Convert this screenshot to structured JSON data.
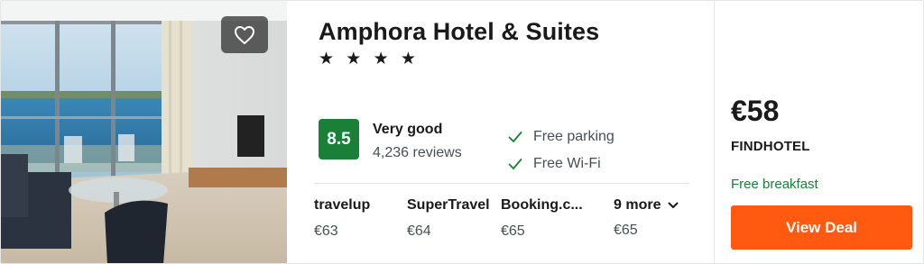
{
  "hotel": {
    "name": "Amphora Hotel & Suites",
    "stars": "★ ★ ★ ★",
    "star_count": 4
  },
  "rating": {
    "score": "8.5",
    "label": "Very good",
    "reviews": "4,236 reviews"
  },
  "amenities": [
    "Free parking",
    "Free Wi-Fi"
  ],
  "providers": [
    {
      "name": "travelup",
      "price": "€63"
    },
    {
      "name": "SuperTravel",
      "price": "€64"
    },
    {
      "name": "Booking.c...",
      "price": "€65"
    }
  ],
  "more": {
    "label": "9 more",
    "price": "€65"
  },
  "deal": {
    "price": "€58",
    "provider": "FINDHOTEL",
    "perk": "Free breakfast",
    "button_label": "View Deal"
  },
  "colors": {
    "accent": "#ff5a10",
    "rating_green": "#1a7f37",
    "perk_green": "#1a7f37"
  },
  "icons": {
    "favorite": "heart-outline-icon",
    "amenity": "check-icon",
    "more": "chevron-down-icon"
  }
}
